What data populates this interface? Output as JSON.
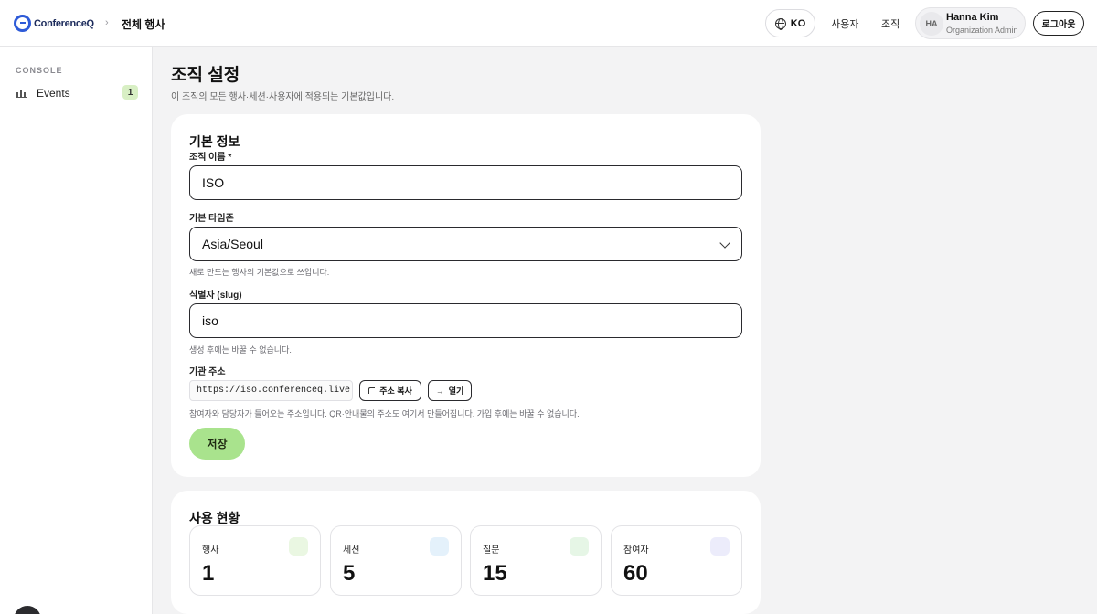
{
  "header": {
    "logo_text": "ConferenceQ",
    "breadcrumb": "전체 행사",
    "lang_label": "KO",
    "nav_users": "사용자",
    "nav_org": "조직",
    "user_initials": "HA",
    "user_name": "Hanna Kim",
    "user_role": "Organization Admin",
    "logout_label": "로그아웃"
  },
  "sidebar": {
    "heading": "CONSOLE",
    "items": [
      {
        "label": "Events",
        "badge": "1"
      }
    ]
  },
  "page": {
    "title": "조직 설정",
    "subtitle": "이 조직의 모든 행사·세션·사용자에 적용되는 기본값입니다."
  },
  "info": {
    "title": "기본 정보",
    "org_name_label": "조직 이름",
    "org_name_required": "*",
    "org_name_value": "ISO",
    "timezone_label": "기본 타임존",
    "timezone_value": "Asia/Seoul",
    "timezone_help": "새로 만드는 행사의 기본값으로 쓰입니다.",
    "slug_label": "식별자 (slug)",
    "slug_value": "iso",
    "slug_help": "생성 후에는 바꿀 수 없습니다.",
    "address_label": "기관 주소",
    "address_value": "https://iso.conferenceq.live",
    "copy_label": "주소 복사",
    "open_label": "열기",
    "address_help": "참여자와 담당자가 들어오는 주소입니다. QR·안내물의 주소도 여기서 만들어집니다. 가입 후에는 바꿀 수 없습니다.",
    "save_label": "저장"
  },
  "usage": {
    "title": "사용 현황",
    "stats": [
      {
        "label": "행사",
        "value": "1",
        "color": "#eaf7e2"
      },
      {
        "label": "세션",
        "value": "5",
        "color": "#e4f1fb"
      },
      {
        "label": "질문",
        "value": "15",
        "color": "#e6f6e6"
      },
      {
        "label": "참여자",
        "value": "60",
        "color": "#ececfb"
      }
    ]
  },
  "colors": {
    "accent_green": "#a9e38d",
    "brand_blue": "#2e5bd8"
  }
}
